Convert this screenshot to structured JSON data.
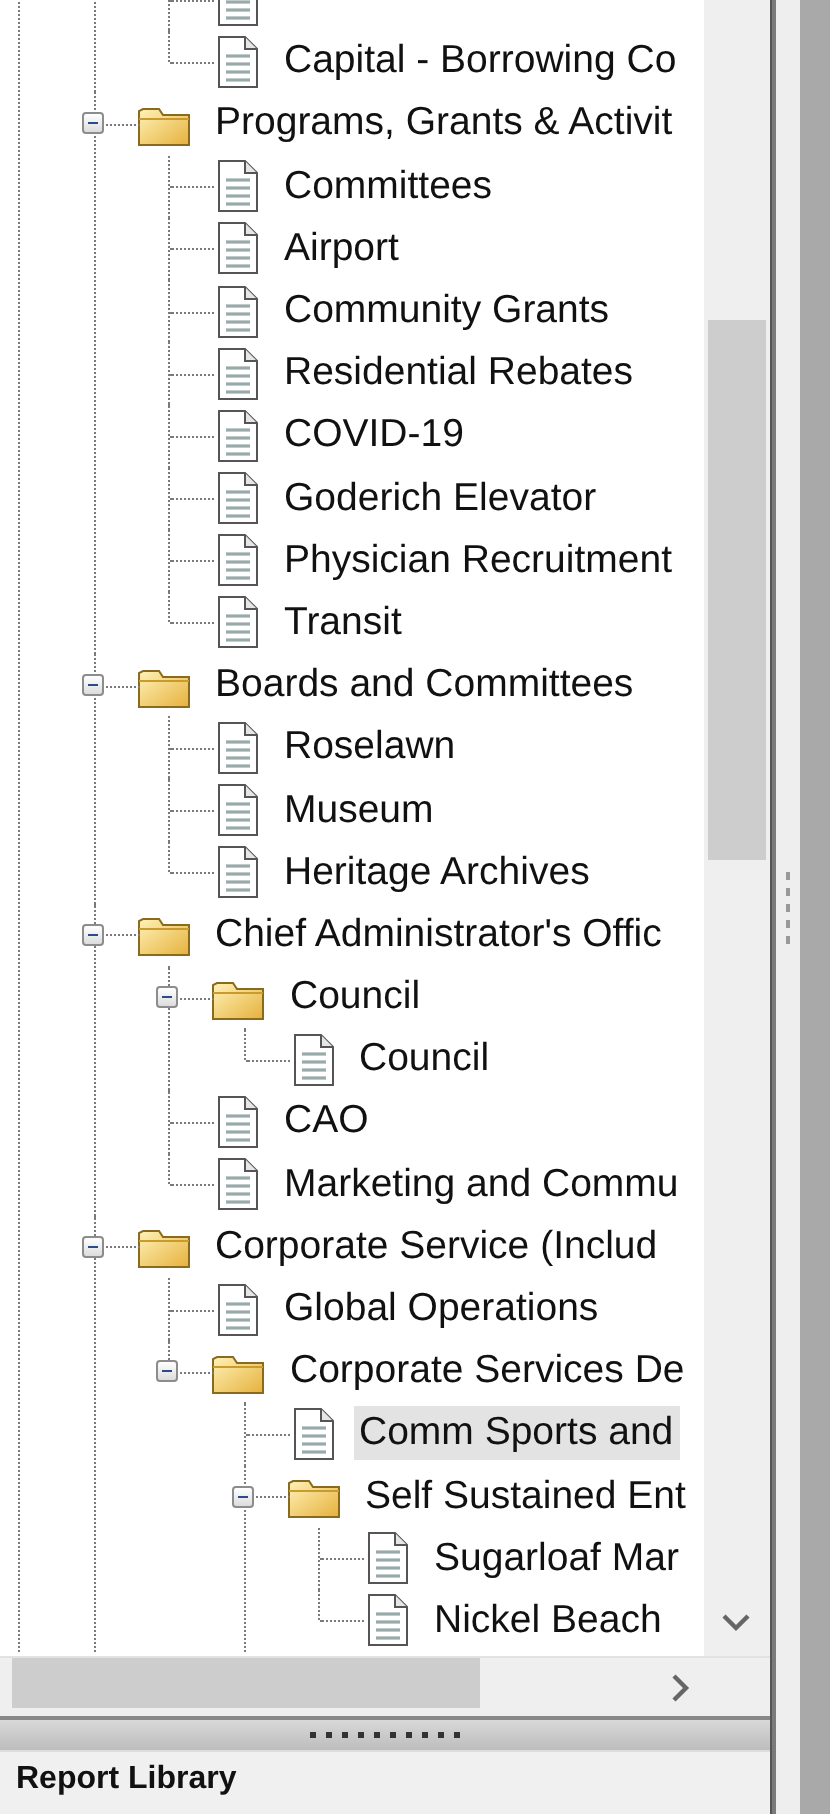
{
  "tree": [
    {
      "kind": "offscreen",
      "continues": true,
      "children": [
        {
          "kind": "offscreen",
          "children": [
            {
              "kind": "doc"
            },
            {
              "kind": "doc",
              "label": "Capital - Borrowing Co",
              "selected": false
            }
          ]
        },
        {
          "kind": "folder",
          "label": "Programs, Grants & Activit",
          "expanded": true,
          "selected": false,
          "children": [
            {
              "kind": "doc",
              "label": "Committees",
              "selected": false
            },
            {
              "kind": "doc",
              "label": "Airport",
              "selected": false
            },
            {
              "kind": "doc",
              "label": "Community Grants",
              "selected": false
            },
            {
              "kind": "doc",
              "label": "Residential Rebates",
              "selected": false
            },
            {
              "kind": "doc",
              "label": "COVID-19",
              "selected": false
            },
            {
              "kind": "doc",
              "label": "Goderich Elevator",
              "selected": false
            },
            {
              "kind": "doc",
              "label": "Physician Recruitment",
              "selected": false
            },
            {
              "kind": "doc",
              "label": "Transit",
              "selected": false
            }
          ]
        },
        {
          "kind": "folder",
          "label": "Boards and Committees",
          "expanded": true,
          "selected": false,
          "children": [
            {
              "kind": "doc",
              "label": "Roselawn",
              "selected": false
            },
            {
              "kind": "doc",
              "label": "Museum",
              "selected": false
            },
            {
              "kind": "doc",
              "label": "Heritage Archives",
              "selected": false
            }
          ]
        },
        {
          "kind": "folder",
          "label": "Chief Administrator's Offic",
          "expanded": true,
          "selected": false,
          "children": [
            {
              "kind": "folder",
              "label": "Council",
              "expanded": true,
              "selected": false,
              "children": [
                {
                  "kind": "doc",
                  "label": "Council",
                  "selected": false
                }
              ]
            },
            {
              "kind": "doc",
              "label": "CAO",
              "selected": false
            },
            {
              "kind": "doc",
              "label": "Marketing and Commu",
              "selected": false
            }
          ]
        },
        {
          "kind": "folder",
          "label": "Corporate Service (Includ",
          "expanded": true,
          "selected": false,
          "continues": true,
          "children": [
            {
              "kind": "doc",
              "label": "Global Operations",
              "selected": false
            },
            {
              "kind": "folder",
              "label": "Corporate Services De",
              "expanded": true,
              "selected": false,
              "children": [
                {
                  "kind": "doc",
                  "label": "Comm Sports and",
                  "selected": true
                },
                {
                  "kind": "folder",
                  "label": "Self Sustained Ent",
                  "expanded": true,
                  "selected": false,
                  "continues": true,
                  "children": [
                    {
                      "kind": "doc",
                      "label": "Sugarloaf Mar",
                      "selected": false
                    },
                    {
                      "kind": "doc",
                      "label": "Nickel Beach",
                      "selected": false
                    }
                  ]
                }
              ]
            }
          ]
        }
      ]
    }
  ],
  "bottom_panel": {
    "title": "Report Library"
  }
}
